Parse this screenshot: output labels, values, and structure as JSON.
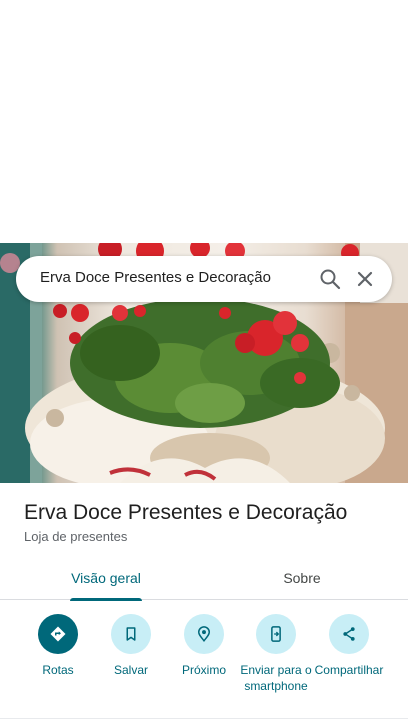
{
  "search": {
    "query": "Erva Doce Presentes e Decoração"
  },
  "photo": {
    "subject": "red-flowers-gift-basket-image"
  },
  "place": {
    "title": "Erva Doce Presentes e Decoração",
    "category": "Loja de presentes"
  },
  "tabs": [
    {
      "label": "Visão geral",
      "selected": true
    },
    {
      "label": "Sobre",
      "selected": false
    }
  ],
  "actions": [
    {
      "label": "Rotas",
      "icon": "directions-icon"
    },
    {
      "label": "Salvar",
      "icon": "bookmark-icon"
    },
    {
      "label": "Próximo",
      "icon": "nearby-icon"
    },
    {
      "label": "Enviar para o smartphone",
      "icon": "send-to-phone-icon"
    },
    {
      "label": "Compartilhar",
      "icon": "share-icon"
    }
  ],
  "colors": {
    "accent": "#00687a",
    "action_bg": "#c8eef6"
  }
}
